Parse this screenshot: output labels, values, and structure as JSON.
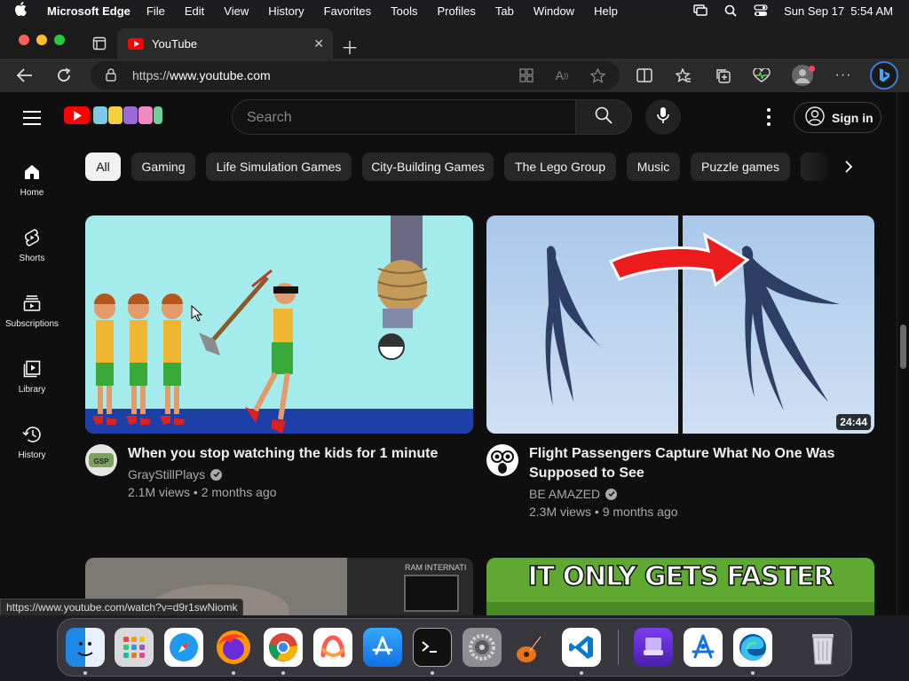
{
  "menubar": {
    "app_name": "Microsoft Edge",
    "items": [
      "File",
      "Edit",
      "View",
      "History",
      "Favorites",
      "Tools",
      "Profiles",
      "Tab",
      "Window",
      "Help"
    ],
    "datetime": "Sun Sep 17  5:54 AM"
  },
  "tab": {
    "title": "YouTube"
  },
  "address": {
    "scheme": "https://",
    "host": "www.youtube.com"
  },
  "youtube": {
    "search_placeholder": "Search",
    "sign_in": "Sign in",
    "nav": [
      {
        "label": "Home",
        "icon": "home-icon"
      },
      {
        "label": "Shorts",
        "icon": "shorts-icon"
      },
      {
        "label": "Subscriptions",
        "icon": "subscriptions-icon"
      },
      {
        "label": "Library",
        "icon": "library-icon"
      },
      {
        "label": "History",
        "icon": "history-icon"
      }
    ],
    "chips": [
      "All",
      "Gaming",
      "Life Simulation Games",
      "City-Building Games",
      "The Lego Group",
      "Music",
      "Puzzle games"
    ],
    "videos": [
      {
        "title": "When you stop watching the kids for 1 minute",
        "channel": "GrayStillPlays",
        "stats": "2.1M views • 2 months ago",
        "duration": ""
      },
      {
        "title": "Flight Passengers Capture What No One Was Supposed to See",
        "channel": "BE AMAZED",
        "stats": "2.3M views • 9 months ago",
        "duration": "24:44"
      }
    ],
    "thumb3_text": "IT ONLY GETS FASTER",
    "status_url": "https://www.youtube.com/watch?v=d9r1swNiomk"
  },
  "dock": [
    "Finder",
    "Launchpad",
    "Safari",
    "Firefox",
    "Chrome",
    "Arc",
    "App Store",
    "Terminal",
    "System Settings",
    "GarageBand",
    "Visual Studio Code",
    "Simulator",
    "Instruments",
    "Microsoft Edge",
    "Trash"
  ],
  "colors": {
    "youtube_red": "#ff0000",
    "edge_blue": "#3a7bd5"
  }
}
